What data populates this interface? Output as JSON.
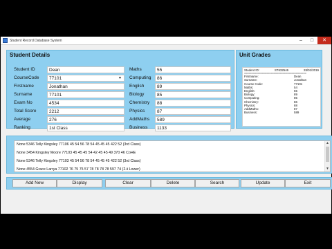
{
  "window": {
    "title": "Student Record Database System",
    "controls": {
      "minimize": "–",
      "maximize": "□",
      "close": "✕"
    }
  },
  "details": {
    "title": "Student Details",
    "left": [
      {
        "label": "Student ID",
        "value": "Dean"
      },
      {
        "label": "CourseCode",
        "value": "77101"
      },
      {
        "label": "Firstname",
        "value": "Jonathan"
      },
      {
        "label": "Surname",
        "value": "77101"
      },
      {
        "label": "Exam No",
        "value": "4534"
      },
      {
        "label": "Total Score",
        "value": "2212"
      },
      {
        "label": "Average",
        "value": "276"
      },
      {
        "label": "Ranking",
        "value": "1st Class"
      }
    ],
    "right": [
      {
        "label": "Maths",
        "value": "55"
      },
      {
        "label": "Computing",
        "value": "86"
      },
      {
        "label": "English",
        "value": "89"
      },
      {
        "label": "Biology",
        "value": "85"
      },
      {
        "label": "Chemistry",
        "value": "88"
      },
      {
        "label": "Physics",
        "value": "87"
      },
      {
        "label": "AddMaths",
        "value": "589"
      },
      {
        "label": "Business",
        "value": "1133"
      }
    ]
  },
  "grades": {
    "title": "Unit Grades",
    "header": {
      "label": "Student ID:",
      "id": "ST632546",
      "date": "28/01/2019"
    },
    "separator": "==========================================",
    "rows": [
      {
        "key": "Firstname:",
        "val": "Dean"
      },
      {
        "key": "Surname:",
        "val": "Jonathan"
      },
      {
        "key": "Course Code:",
        "val": "77101"
      },
      {
        "key": "Maths:",
        "val": "54"
      },
      {
        "key": "English:",
        "val": "55"
      },
      {
        "key": "Biology:",
        "val": "89"
      },
      {
        "key": "Computing:",
        "val": "85"
      },
      {
        "key": "Chemistry:",
        "val": "86"
      },
      {
        "key": "Physics:",
        "val": "88"
      },
      {
        "key": "AddMaths:",
        "val": "87"
      },
      {
        "key": "Business:",
        "val": "589"
      }
    ]
  },
  "records": [
    "None 5346 Telly Kingsley 77106 45 54 56 78 54 45 45 45 422 52 (3rd Class)",
    "None 3454 Kingsley Moore 77103 45 45 45 54 42 45 45 49 370 46 CoHE",
    "None 5346 Telly Kingsley 77103 45 54 56 78 54 45 45 45 422 52 (3rd Class)",
    "None 4554 Grace Larrya 77102 76 75 75 57 78 78 78 78 597 74 (2.ii Lower)"
  ],
  "buttons": [
    "Add New",
    "Display",
    "Clear",
    "Delete",
    "Search",
    "Update",
    "Exit"
  ]
}
